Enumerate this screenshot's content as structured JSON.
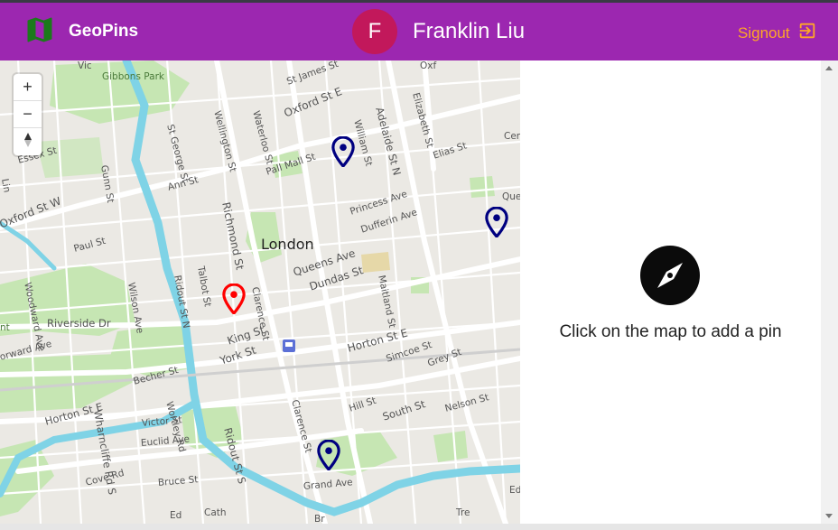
{
  "app": {
    "title": "GeoPins",
    "logo_icon": "map-icon",
    "brand_color": "#9c27b0"
  },
  "user": {
    "initial": "F",
    "name": "Franklin Liu",
    "avatar_color": "#c2185b"
  },
  "header": {
    "signout_label": "Signout",
    "signout_icon": "exit-icon",
    "signout_color": "#ffa726"
  },
  "map": {
    "city_label": "London",
    "zoom_in": "+",
    "zoom_out": "−",
    "compass_control_icon": "north-arrow-icon",
    "street_labels": [
      "Gibbons Park",
      "St James St",
      "Wellington St",
      "Waterloo St",
      "Oxford St E",
      "William St",
      "Adelaide St N",
      "Elizabeth St",
      "Cen",
      "Elias St",
      "St George St",
      "Gunn St",
      "Essex St",
      "Ann St",
      "Richmond St",
      "Pall Mall St",
      "Maitland St",
      "Princess Ave",
      "Dufferin Ave",
      "Oxford St W",
      "Paul St",
      "Woodward Ave",
      "Wilson Ave",
      "Ridout St N",
      "Talbot St",
      "Clarence St",
      "Queens Ave",
      "Dundas St",
      "Riverside Dr",
      "King St",
      "York St",
      "Horton St E",
      "Simcoe St",
      "Grey St",
      "Becher St",
      "Wharncliffe Rd S",
      "Wortley Rd",
      "Ridout St S",
      "Clarence St",
      "Hill St",
      "South St",
      "Nelson St",
      "Horton St E",
      "Victor St",
      "Euclid Ave",
      "Bruce St",
      "Cove Rd",
      "Grand Ave",
      "orward Ave",
      "Que",
      "Ed",
      "nt",
      "Vic",
      "Oxf",
      "Ed",
      "Cath",
      "Tre",
      "Br",
      "Lin"
    ],
    "pins": [
      {
        "name": "pin-oxford-st",
        "color": "#000080",
        "type": "saved"
      },
      {
        "name": "pin-queens-ave-east",
        "color": "#000080",
        "type": "saved"
      },
      {
        "name": "pin-ridout-st",
        "color": "#ff0000",
        "type": "current"
      },
      {
        "name": "pin-grand-ave",
        "color": "#000080",
        "type": "saved"
      }
    ]
  },
  "panel": {
    "icon": "explore-compass-icon",
    "message": "Click on the map to add a pin"
  }
}
